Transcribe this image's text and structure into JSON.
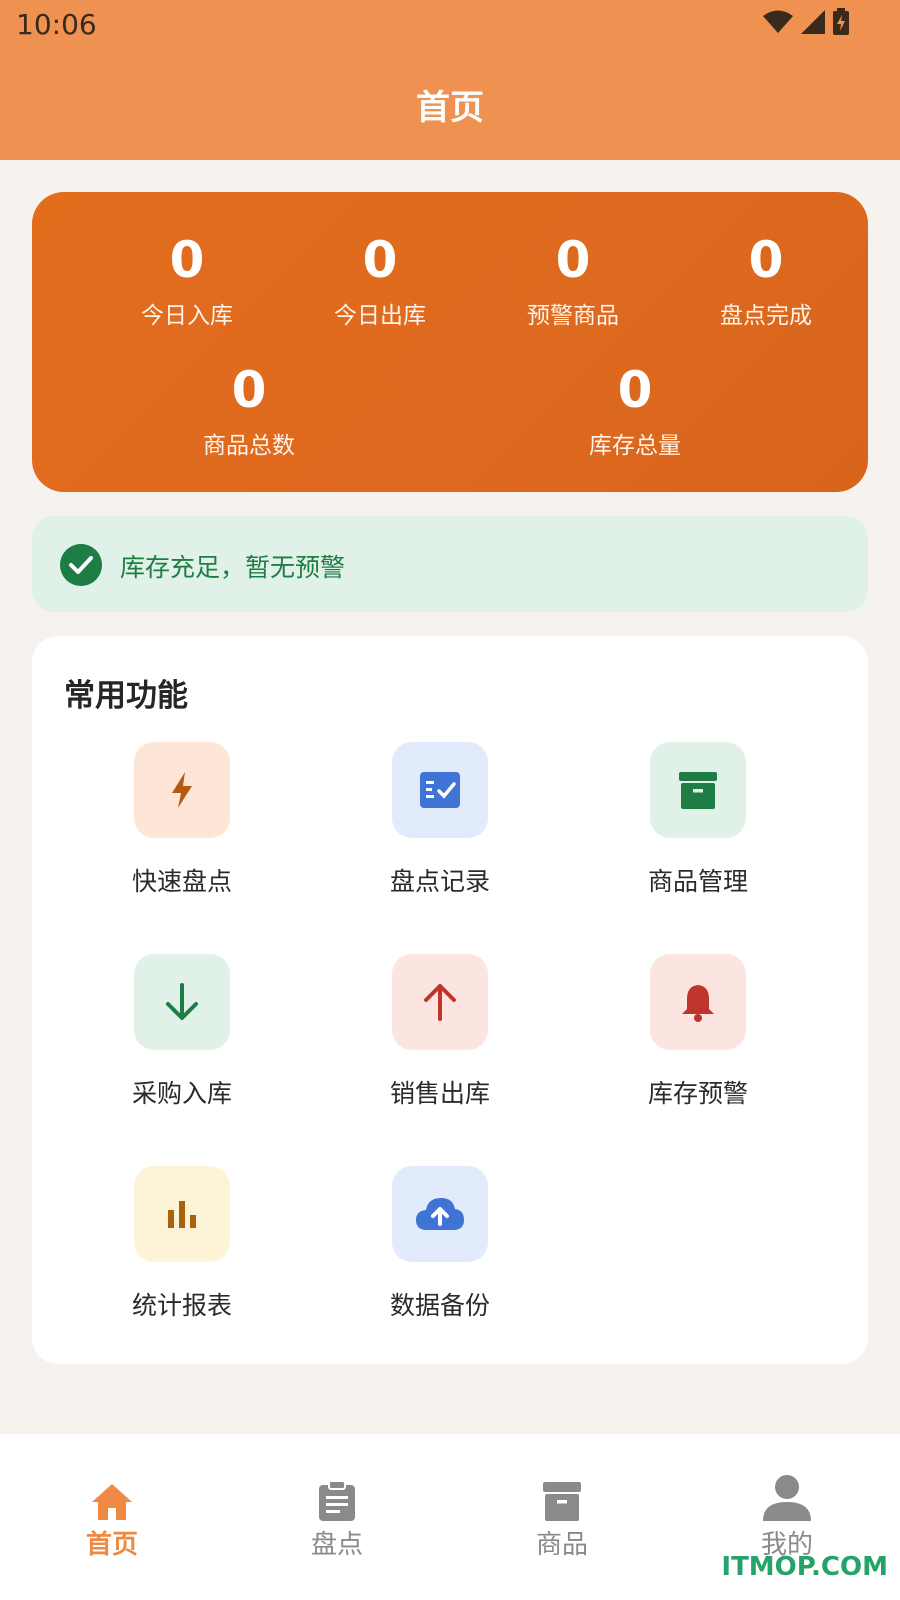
{
  "status_bar": {
    "time": "10:06"
  },
  "app_bar": {
    "title": "首页"
  },
  "stats": {
    "items": [
      {
        "value": "0",
        "label": "今日入库"
      },
      {
        "value": "0",
        "label": "今日出库"
      },
      {
        "value": "0",
        "label": "预警商品"
      },
      {
        "value": "0",
        "label": "盘点完成"
      },
      {
        "value": "0",
        "label": "商品总数"
      },
      {
        "value": "0",
        "label": "库存总量"
      }
    ]
  },
  "notice": {
    "text": "库存充足，暂无预警"
  },
  "functions": {
    "heading": "常用功能",
    "items": [
      {
        "label": "快速盘点",
        "icon": "bolt-icon",
        "bg": "#fde6d6",
        "fg": "#b65a13"
      },
      {
        "label": "盘点记录",
        "icon": "checklist-icon",
        "bg": "#e1ebfb",
        "fg": "#3f74d4"
      },
      {
        "label": "商品管理",
        "icon": "archive-icon",
        "bg": "#e0f2e7",
        "fg": "#1e7d45"
      },
      {
        "label": "采购入库",
        "icon": "arrow-down-icon",
        "bg": "#e0f2e7",
        "fg": "#1e7d45"
      },
      {
        "label": "销售出库",
        "icon": "arrow-up-icon",
        "bg": "#fce4e1",
        "fg": "#c0352b"
      },
      {
        "label": "库存预警",
        "icon": "bell-icon",
        "bg": "#fce4e1",
        "fg": "#c0352b"
      },
      {
        "label": "统计报表",
        "icon": "bar-chart-icon",
        "bg": "#fdf3d7",
        "fg": "#a8620d"
      },
      {
        "label": "数据备份",
        "icon": "cloud-upload-icon",
        "bg": "#e1ebfb",
        "fg": "#3f74d4"
      }
    ]
  },
  "tab_bar": {
    "items": [
      {
        "label": "首页",
        "icon": "home-icon",
        "active": true
      },
      {
        "label": "盘点",
        "icon": "clipboard-icon",
        "active": false
      },
      {
        "label": "商品",
        "icon": "archive-icon",
        "active": false
      },
      {
        "label": "我的",
        "icon": "person-icon",
        "active": false
      }
    ]
  },
  "watermark": "ITMOP.COM",
  "colors": {
    "accent": "#ef9150",
    "stats_bg": "#e06b1e",
    "success": "#1e7d45",
    "tab_active": "#ef8a44",
    "tab_inactive": "#8a8a8a"
  }
}
